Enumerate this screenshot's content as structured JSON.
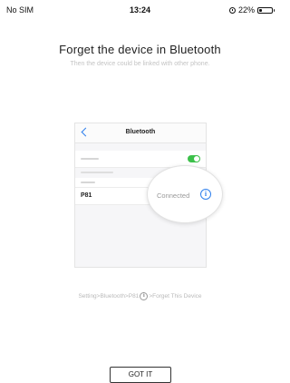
{
  "status_bar": {
    "carrier": "No SIM",
    "time": "13:24",
    "battery": "22%",
    "battery_level": 0.22,
    "icons": [
      "alarm-icon",
      "battery-icon"
    ]
  },
  "header": {
    "title": "Forget the device in Bluetooth",
    "subtitle": "Then the device could be linked with other phone."
  },
  "illustration": {
    "nav_title": "Bluetooth",
    "device_name": "P81",
    "device_status": "Connected",
    "toggle_on": true,
    "accent_color": "#2f80ed",
    "toggle_color": "#3cc04a"
  },
  "hint": {
    "path_prefix": "Setting>Bluetooth>P81",
    "path_suffix": ">Forget This Device"
  },
  "actions": {
    "got_it_label": "GOT IT"
  }
}
